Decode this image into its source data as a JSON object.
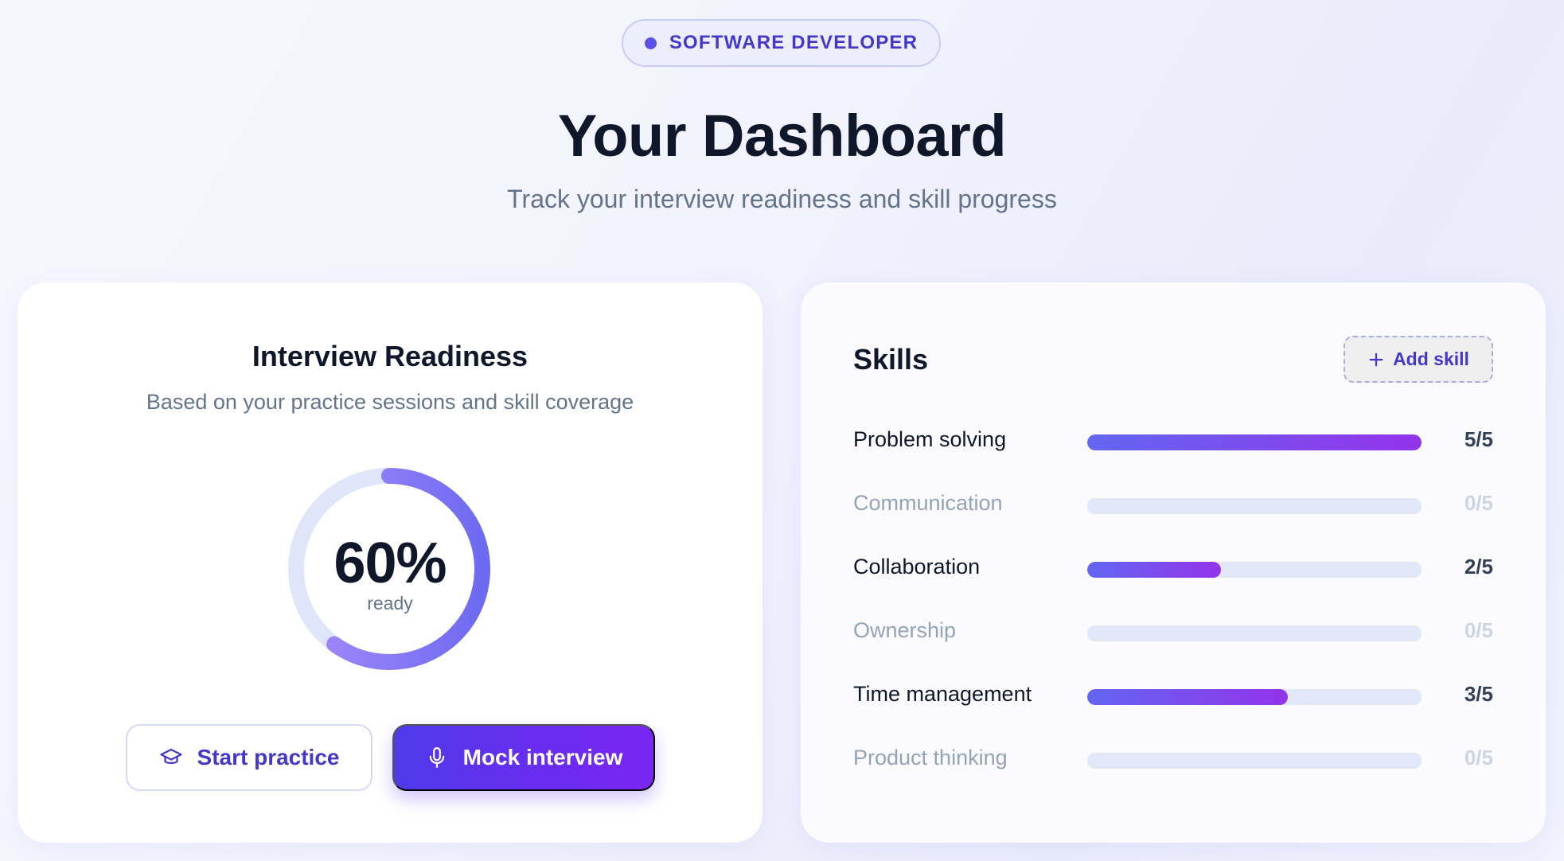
{
  "header": {
    "role_badge": "SOFTWARE DEVELOPER",
    "title": "Your Dashboard",
    "subtitle": "Track your interview readiness and skill progress"
  },
  "readiness": {
    "title": "Interview Readiness",
    "subtitle": "Based on your practice sessions and skill coverage",
    "percent": 60,
    "percent_label": "60%",
    "status": "ready",
    "start_practice_label": "Start practice",
    "mock_interview_label": "Mock interview"
  },
  "skills": {
    "title": "Skills",
    "add_label": "Add skill",
    "items": [
      {
        "name": "Problem solving",
        "score": 5,
        "max": 5,
        "label": "5/5"
      },
      {
        "name": "Communication",
        "score": 0,
        "max": 5,
        "label": "0/5"
      },
      {
        "name": "Collaboration",
        "score": 2,
        "max": 5,
        "label": "2/5"
      },
      {
        "name": "Ownership",
        "score": 0,
        "max": 5,
        "label": "0/5"
      },
      {
        "name": "Time management",
        "score": 3,
        "max": 5,
        "label": "3/5"
      },
      {
        "name": "Product thinking",
        "score": 0,
        "max": 5,
        "label": "0/5"
      }
    ]
  },
  "icons": {
    "badge": "dot-icon",
    "start_practice": "graduation-cap-icon",
    "mock_interview": "microphone-icon",
    "add_skill": "plus-icon"
  },
  "colors": {
    "accent": "#4338ca",
    "primary_start": "#4f3ae8",
    "primary_end": "#7b26f2",
    "track": "#e2e8f8",
    "ring_track": "#e0e6fa"
  }
}
